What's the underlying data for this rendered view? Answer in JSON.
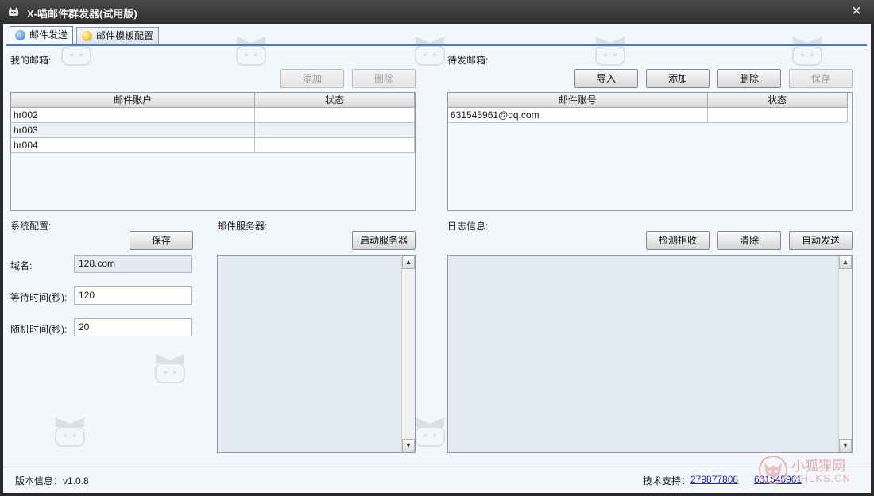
{
  "window": {
    "title": "X-喵邮件群发器(试用版)",
    "close": "✕"
  },
  "tabs": [
    {
      "label": "邮件发送",
      "active": true,
      "icon": "blue-globe-icon"
    },
    {
      "label": "邮件模板配置",
      "active": false,
      "icon": "yellow-globe-icon"
    }
  ],
  "my_mailbox": {
    "title": "我的邮箱:",
    "add_label": "添加",
    "delete_label": "删除",
    "columns": [
      "邮件账户",
      "状态"
    ],
    "rows": [
      [
        "hr002",
        ""
      ],
      [
        "hr003",
        ""
      ],
      [
        "hr004",
        ""
      ]
    ]
  },
  "pending_mailbox": {
    "title": "待发邮箱:",
    "import_label": "导入",
    "add_label": "添加",
    "delete_label": "删除",
    "save_label": "保存",
    "columns": [
      "邮件账号",
      "状态"
    ],
    "rows": [
      [
        "631545961@qq.com",
        ""
      ]
    ]
  },
  "system_config": {
    "title": "系统配置:",
    "save_label": "保存",
    "domain_label": "域名:",
    "domain_value": "128.com",
    "wait_label": "等待时间(秒):",
    "wait_value": "120",
    "random_label": "随机时间(秒):",
    "random_value": "20"
  },
  "mail_server": {
    "title": "邮件服务器:",
    "start_label": "启动服务器"
  },
  "log": {
    "title": "日志信息:",
    "detect_label": "检测拒收",
    "clear_label": "清除",
    "auto_send_label": "自动发送"
  },
  "status_bar": {
    "version": "版本信息：v1.0.8",
    "support_label": "技术支持：",
    "support_qq1": "279877808",
    "support_qq2": "631545961"
  },
  "watermark": {
    "brand": "小狐狸网",
    "url": "XHLKS.CN"
  },
  "colors": {
    "title_bar": "#2e2e2e",
    "client_bg": "#f3f7fb",
    "tab_accent": "#4d7fb8",
    "link": "#2a2aa8"
  }
}
